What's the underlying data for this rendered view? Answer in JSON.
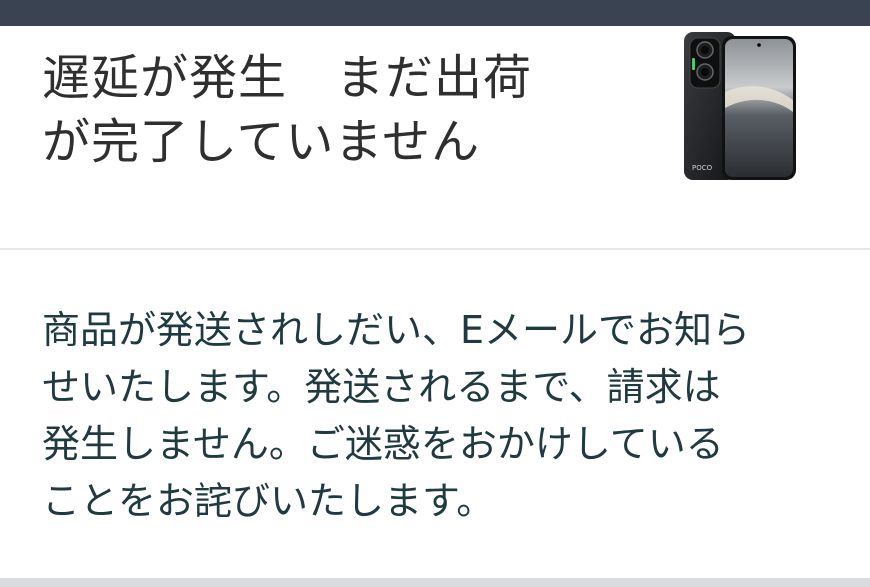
{
  "header": {
    "title": "遅延が発生　まだ出荷\nが完了していません",
    "product_image": "smartphone-product-image"
  },
  "message": {
    "body": "商品が発送されしだい、Eメールでお知ら\nせいたします。発送されるまで、請求は\n発生しません。ご迷惑をおかけしている\nことをお詫びいたします。"
  },
  "colors": {
    "top_bar": "#3a4352",
    "title_text": "#2f2f2f",
    "body_text": "#1f3a40",
    "divider": "#e4e6e9"
  }
}
